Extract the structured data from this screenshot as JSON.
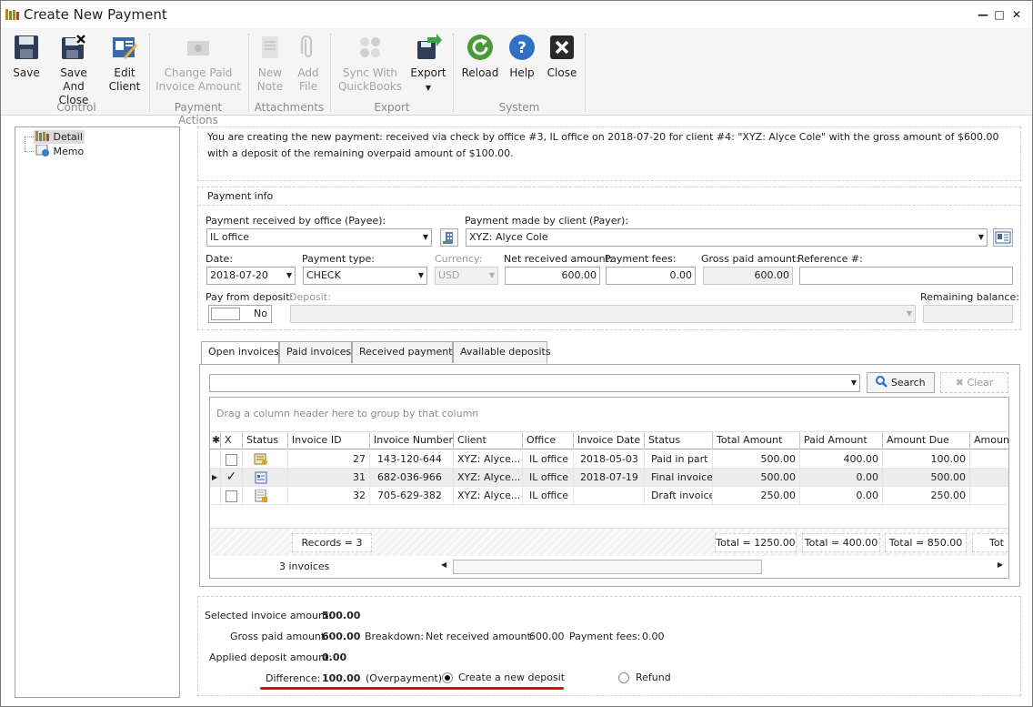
{
  "window": {
    "title": "Create New Payment",
    "minimize": "—",
    "restore": "□",
    "close": "✕"
  },
  "ribbon": {
    "save": "Save",
    "save_and_close": [
      "Save And",
      "Close"
    ],
    "edit_client": [
      "Edit",
      "Client"
    ],
    "change_paid": [
      "Change Paid",
      "Invoice Amount"
    ],
    "new_note": [
      "New",
      "Note"
    ],
    "add_file": [
      "Add",
      "File"
    ],
    "sync_qb": [
      "Sync With",
      "QuickBooks"
    ],
    "export": "Export",
    "reload": "Reload",
    "help": "Help",
    "close": "Close",
    "groups": {
      "control": "Control",
      "payment_actions": "Payment Actions",
      "attachments": "Attachments",
      "export": "Export",
      "system": "System"
    }
  },
  "tree": {
    "items": [
      {
        "label": "Detail",
        "icon": "detail-icon"
      },
      {
        "label": "Memo",
        "icon": "memo-icon"
      }
    ]
  },
  "info_text": "You are creating the new payment: received via check by office #3, IL office on 2018-07-20 for client #4: \"XYZ: Alyce Cole\" with the gross amount of $600.00 with a deposit of the remaining overpaid amount of $100.00.",
  "payment_info": {
    "section_title": "Payment info",
    "office_label": "Payment received by office (Payee):",
    "office_value": "IL office",
    "client_label": "Payment made by client (Payer):",
    "client_value": "XYZ: Alyce Cole",
    "date_label": "Date:",
    "date_value": "2018-07-20",
    "type_label": "Payment type:",
    "type_value": "CHECK",
    "currency_label": "Currency:",
    "currency_value": "USD",
    "net_label": "Net received amount:",
    "net_value": "600.00",
    "fees_label": "Payment fees:",
    "fees_value": "0.00",
    "gross_label": "Gross paid amount:",
    "gross_value": "600.00",
    "reference_label": "Reference #:",
    "reference_value": "",
    "pay_from_deposit_label": "Pay from deposit:",
    "pay_from_deposit_value": "No",
    "deposit_label": "Deposit:",
    "deposit_value": "",
    "remaining_label": "Remaining balance:",
    "remaining_value": ""
  },
  "tabs": [
    "Open invoices",
    "Paid invoices",
    "Received payments",
    "Available deposits"
  ],
  "search": {
    "filter_value": "",
    "search_label": "Search",
    "clear_label": "Clear"
  },
  "grid": {
    "group_hint": "Drag a column header here to group by that column",
    "columns": [
      "X",
      "Status",
      "Invoice ID",
      "Invoice Number",
      "Client",
      "Office",
      "Invoice Date",
      "Status",
      "Total Amount",
      "Paid Amount",
      "Amount Due",
      "Amount"
    ],
    "rows": [
      {
        "checked": false,
        "status_icon": "partial-invoice-icon",
        "invoice_id": "27",
        "invoice_number": "143-120-644",
        "client": "XYZ: Alyce...",
        "office": "IL office",
        "invoice_date": "2018-05-03",
        "status": "Paid in part",
        "total": "500.00",
        "paid": "400.00",
        "due": "100.00",
        "amount": ""
      },
      {
        "checked": true,
        "status_icon": "final-invoice-icon",
        "invoice_id": "31",
        "invoice_number": "682-036-966",
        "client": "XYZ: Alyce...",
        "office": "IL office",
        "invoice_date": "2018-07-19",
        "status": "Final invoice",
        "total": "500.00",
        "paid": "0.00",
        "due": "500.00",
        "amount": ""
      },
      {
        "checked": false,
        "status_icon": "draft-invoice-icon",
        "invoice_id": "32",
        "invoice_number": "705-629-382",
        "client": "XYZ: Alyce...",
        "office": "IL office",
        "invoice_date": "",
        "status": "Draft invoice",
        "total": "250.00",
        "paid": "0.00",
        "due": "250.00",
        "amount": ""
      }
    ],
    "footer": {
      "records": "Records = 3",
      "total_amount": "Total = 1250.00",
      "total_paid": "Total = 400.00",
      "total_due": "Total = 850.00",
      "total_amount_col": "Tot"
    },
    "status_text": "3 invoices"
  },
  "summary": {
    "selected_label": "Selected invoice amount:",
    "selected_value": "500.00",
    "gross_label": "Gross paid amount:",
    "gross_value": "600.00",
    "breakdown_label": "Breakdown:",
    "net_label": "Net received amount:",
    "net_value": "600.00",
    "fees_label": "Payment fees:",
    "fees_value": "0.00",
    "applied_label": "Applied deposit amount:",
    "applied_value": "0.00",
    "difference_label": "Difference:",
    "difference_value": "100.00",
    "difference_note": "(Overpayment)",
    "create_deposit_label": "Create a new deposit",
    "refund_label": "Refund",
    "underline_color": "#d0141b"
  }
}
